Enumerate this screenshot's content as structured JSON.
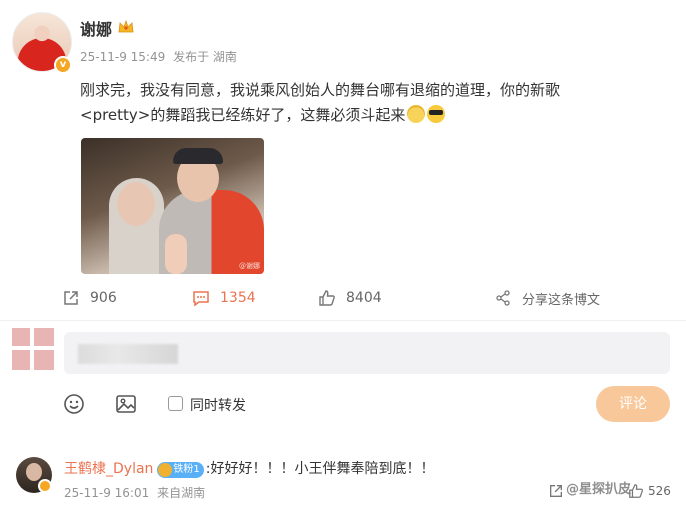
{
  "post": {
    "username": "谢娜",
    "meta": {
      "date": "25-11-9 15:49",
      "source": "发布于 湖南"
    },
    "text_line1": "刚求完，我没有同意，我说乘风创始人的舞台哪有退缩的道理，你的新歌",
    "text_line2": "<pretty>的舞蹈我已经练好了，这舞必须斗起来",
    "emojis": [
      "chewing-emoji",
      "sunglasses-emoji"
    ],
    "image_watermark": "@谢娜"
  },
  "actions": {
    "repost_count": "906",
    "comment_count": "1354",
    "like_count": "8404",
    "share_label": "分享这条博文"
  },
  "composer": {
    "repost_label": "同时转发",
    "submit_label": "评论"
  },
  "reply": {
    "username": "王鹤棣_Dylan",
    "fan_badge": "铁粉1",
    "text": ":好好好！！！小王伴舞奉陪到底！！",
    "date": "25-11-9 16:01",
    "source": "来自湖南",
    "like_count": "526"
  },
  "overlay_watermark": "@星探扒皮",
  "colors": {
    "accent": "#eb7350",
    "submit_bg": "#f8c89b",
    "input_bg": "#f2f2f5"
  }
}
